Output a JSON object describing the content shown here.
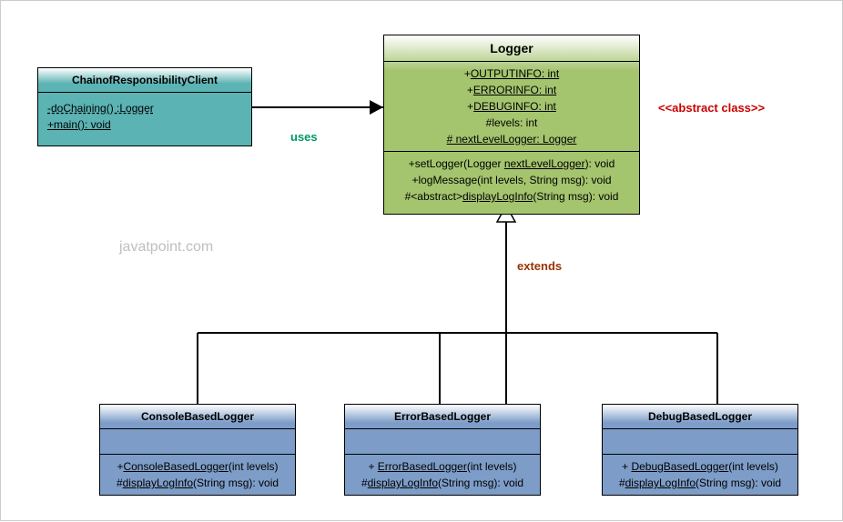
{
  "watermark": "javatpoint.com",
  "labels": {
    "uses": "uses",
    "extends": "extends",
    "abstract": "<<abstract class>>"
  },
  "client": {
    "name": "ChainofResponsibilityClient",
    "methods": {
      "m1": "-doChaining() :Logger",
      "m2": "+main(): void"
    }
  },
  "logger": {
    "name": "Logger",
    "attrs": {
      "a1a": "+",
      "a1b": "OUTPUTINFO: int",
      "a2a": "+",
      "a2b": "ERRORINFO: int",
      "a3a": "+",
      "a3b": "DEBUGINFO: int",
      "a4": "#levels: int",
      "a5": "# nextLevelLogger: Logger"
    },
    "methods": {
      "m1a": "+setLogger(Logger ",
      "m1b": "nextLevelLogger",
      "m1c": "): void",
      "m2": "+logMessage(int levels, String msg): void",
      "m3a": "#<abstract>",
      "m3b": "displayLogInfo",
      "m3c": "(String msg): void"
    }
  },
  "console": {
    "name": "ConsoleBasedLogger",
    "methods": {
      "m1a": "+",
      "m1b": "ConsoleBasedLogger",
      "m1c": "(int levels)",
      "m2a": "#",
      "m2b": "displayLogInfo",
      "m2c": "(String msg): void"
    }
  },
  "error": {
    "name": "ErrorBasedLogger",
    "methods": {
      "m1a": "+ ",
      "m1b": "ErrorBasedLogger",
      "m1c": "(int levels)",
      "m2a": "#",
      "m2b": "displayLogInfo",
      "m2c": "(String msg): void"
    }
  },
  "debug": {
    "name": "DebugBasedLogger",
    "methods": {
      "m1a": "+ ",
      "m1b": "DebugBasedLogger",
      "m1c": "(int levels)",
      "m2a": "#",
      "m2b": "displayLogInfo",
      "m2c": "(String msg): void"
    }
  }
}
